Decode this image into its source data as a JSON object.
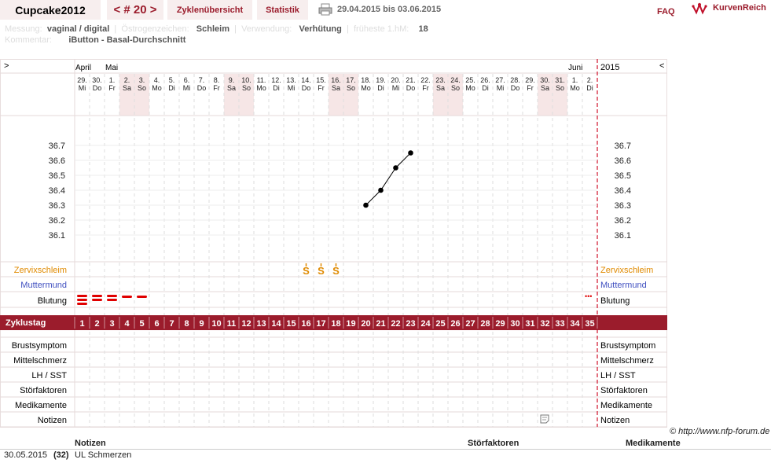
{
  "header": {
    "user": "Cupcake2012",
    "cycle_nav": "< # 20 >",
    "tab_overview": "Zyklenübersicht",
    "tab_stats": "Statistik",
    "date_range": "29.04.2015 bis 03.06.2015",
    "faq": "FAQ",
    "brand": "KurvenReich"
  },
  "meta": {
    "messung_label": "Messung:",
    "messung": "vaginal / digital",
    "oest_label": "Östrogenzeichen:",
    "oest": "Schleim",
    "sep1": "|",
    "verw_label": "Verwendung:",
    "verw": "Verhütung",
    "sep2": "|",
    "hm_label": "früheste 1.hM:",
    "hm": "18",
    "komm_label": "Kommentar:",
    "komm": "iButton - Basal-Durchschnitt"
  },
  "nav": {
    "prev": ">",
    "next": "<",
    "year": "2015"
  },
  "months": [
    {
      "label": "April",
      "col": 0
    },
    {
      "label": "Mai",
      "col": 2
    },
    {
      "label": "Juni",
      "col": 33
    }
  ],
  "days": [
    [
      "29.",
      "Mi"
    ],
    [
      "30.",
      "Do"
    ],
    [
      "1.",
      "Fr"
    ],
    [
      "2.",
      "Sa"
    ],
    [
      "3.",
      "So"
    ],
    [
      "4.",
      "Mo"
    ],
    [
      "5.",
      "Di"
    ],
    [
      "6.",
      "Mi"
    ],
    [
      "7.",
      "Do"
    ],
    [
      "8.",
      "Fr"
    ],
    [
      "9.",
      "Sa"
    ],
    [
      "10.",
      "So"
    ],
    [
      "11.",
      "Mo"
    ],
    [
      "12.",
      "Di"
    ],
    [
      "13.",
      "Mi"
    ],
    [
      "14.",
      "Do"
    ],
    [
      "15.",
      "Fr"
    ],
    [
      "16.",
      "Sa"
    ],
    [
      "17.",
      "So"
    ],
    [
      "18.",
      "Mo"
    ],
    [
      "19.",
      "Di"
    ],
    [
      "20.",
      "Mi"
    ],
    [
      "21.",
      "Do"
    ],
    [
      "22.",
      "Fr"
    ],
    [
      "23.",
      "Sa"
    ],
    [
      "24.",
      "So"
    ],
    [
      "25.",
      "Mo"
    ],
    [
      "26.",
      "Di"
    ],
    [
      "27.",
      "Mi"
    ],
    [
      "28.",
      "Do"
    ],
    [
      "29.",
      "Fr"
    ],
    [
      "30.",
      "Sa"
    ],
    [
      "31.",
      "So"
    ],
    [
      "1.",
      "Mo"
    ],
    [
      "2.",
      "Di"
    ]
  ],
  "weekend_cols": [
    3,
    4,
    10,
    11,
    17,
    18,
    24,
    25,
    31,
    32
  ],
  "chart_data": {
    "type": "line",
    "y_ticks": [
      "36.7",
      "36.6",
      "36.5",
      "36.4",
      "36.3",
      "36.2",
      "36.1"
    ],
    "ylim": [
      36.0,
      36.8
    ],
    "series": [
      {
        "x_cycle_day": [
          20,
          21,
          22,
          23
        ],
        "values": [
          36.3,
          36.4,
          36.55,
          36.65
        ]
      }
    ]
  },
  "rows": {
    "zervix": "Zervixschleim",
    "mutter": "Muttermund",
    "blutung": "Blutung",
    "zyklustag": "Zyklustag",
    "brust": "Brustsymptom",
    "mittel": "Mittelschmerz",
    "lh": "LH / SST",
    "stoer": "Störfaktoren",
    "medi": "Medikamente",
    "notizen": "Notizen"
  },
  "zervix_mark": "S",
  "zervix_cols": [
    15,
    16,
    17
  ],
  "bleeding": [
    {
      "col": 0,
      "level": "heavy"
    },
    {
      "col": 1,
      "level": "medium"
    },
    {
      "col": 2,
      "level": "medium"
    },
    {
      "col": 3,
      "level": "light"
    },
    {
      "col": 4,
      "level": "light"
    }
  ],
  "bleed_mark": "•••",
  "notes_col": 31,
  "cycle_days": [
    "1",
    "2",
    "3",
    "4",
    "5",
    "6",
    "7",
    "8",
    "9",
    "10",
    "11",
    "12",
    "13",
    "14",
    "15",
    "16",
    "17",
    "18",
    "19",
    "20",
    "21",
    "22",
    "23",
    "24",
    "25",
    "26",
    "27",
    "28",
    "29",
    "30",
    "31",
    "32",
    "33",
    "34",
    "35"
  ],
  "copyright": "© http://www.nfp-forum.de",
  "notes_table": {
    "h_notizen": "Notizen",
    "h_stoer": "Störfaktoren",
    "h_medi": "Medikamente",
    "date": "30.05.2015",
    "day": "(32)",
    "text": "UL Schmerzen"
  },
  "colors": {
    "accent": "#9b1c2c",
    "zervix": "#e08a00",
    "mutter": "#4050c0",
    "bleed": "#e00000"
  }
}
